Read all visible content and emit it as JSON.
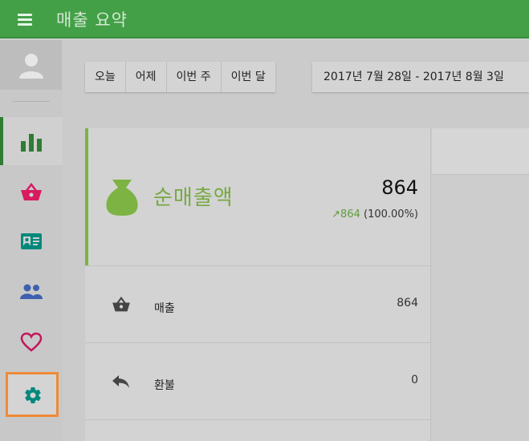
{
  "header": {
    "title": "매출 요약",
    "menu_icon": "hamburger-menu-icon"
  },
  "sidebar": {
    "avatar_icon": "user-avatar-icon",
    "items": [
      {
        "id": "reports",
        "icon": "bar-chart-icon",
        "active": true,
        "color": "#2e7d32"
      },
      {
        "id": "orders",
        "icon": "shopping-basket-icon",
        "active": false,
        "color": "#d81b60"
      },
      {
        "id": "customers",
        "icon": "id-card-icon",
        "active": false,
        "color": "#00897b"
      },
      {
        "id": "users",
        "icon": "people-icon",
        "active": false,
        "color": "#3f5fb0"
      },
      {
        "id": "favorites",
        "icon": "heart-icon",
        "active": false,
        "color": "#c2185b"
      },
      {
        "id": "settings",
        "icon": "gear-icon",
        "active": false,
        "focused": true,
        "color": "#00897b"
      }
    ]
  },
  "toolbar": {
    "range_buttons": [
      "오늘",
      "어제",
      "이번 주",
      "이번 달"
    ],
    "date_range": "2017년 7월 28일 - 2017년 8월 3일"
  },
  "summary": {
    "net_sales": {
      "title": "순매출액",
      "value": "864",
      "change_value": "864",
      "change_percent": "(100.00%)",
      "accent_color": "#7cb342"
    },
    "rows": [
      {
        "label": "매출",
        "value": "864",
        "icon": "shopping-basket-icon"
      },
      {
        "label": "환불",
        "value": "0",
        "icon": "reply-arrow-icon"
      }
    ]
  },
  "colors": {
    "header_bg": "#43a047",
    "focus_outline": "#ef8a35"
  }
}
